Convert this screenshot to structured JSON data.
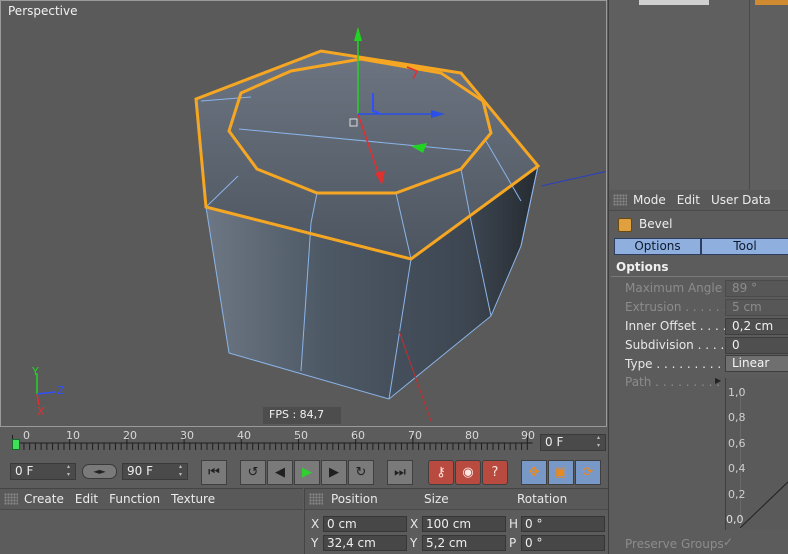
{
  "viewport": {
    "title": "Perspective",
    "fps": "FPS : 84,7"
  },
  "attributes": {
    "menu": [
      "Mode",
      "Edit",
      "User Data"
    ],
    "tool_name": "Bevel",
    "tabs": [
      "Options",
      "Tool"
    ],
    "section": "Options",
    "params": [
      {
        "label": "Maximum Angle",
        "value": "89 °",
        "enabled": false
      },
      {
        "label": "Extrusion . . . . . . .",
        "value": "5 cm",
        "enabled": false
      },
      {
        "label": "Inner Offset . . . . .",
        "value": "0,2 cm",
        "enabled": true
      },
      {
        "label": "Subdivision . . . . .",
        "value": "0",
        "enabled": true
      },
      {
        "label": "Type . . . . . . . . .",
        "value": "Linear",
        "enabled": true
      },
      {
        "label": "Path . . . . . . . . . .",
        "value": "",
        "enabled": false
      }
    ],
    "graph_ticks": [
      "1,0",
      "0,8",
      "0,6",
      "0,4",
      "0,2",
      "0,0"
    ],
    "preserve_groups": "Preserve Groups"
  },
  "timeline": {
    "ticks": [
      "0",
      "10",
      "20",
      "30",
      "40",
      "50",
      "60",
      "70",
      "80",
      "90"
    ],
    "current_frame": "0 F"
  },
  "transport": {
    "start_frame": "0 F",
    "end_frame": "90 F",
    "loop_label": "◄►"
  },
  "materials_menu": [
    "Create",
    "Edit",
    "Function",
    "Texture"
  ],
  "coords": {
    "headers": [
      "Position",
      "Size",
      "Rotation"
    ],
    "rows": [
      {
        "axis1": "X",
        "pos": "0 cm",
        "axis2": "X",
        "size": "100 cm",
        "axis3": "H",
        "rot": "0 °"
      },
      {
        "axis1": "Y",
        "pos": "32,4 cm",
        "axis2": "Y",
        "size": "5,2 cm",
        "axis3": "P",
        "rot": "0 °"
      }
    ]
  },
  "colors": {
    "selection": "#f5a623",
    "edge": "#8ab4e8",
    "accent_tab": "#8fb0de",
    "play": "#2fd02f"
  }
}
